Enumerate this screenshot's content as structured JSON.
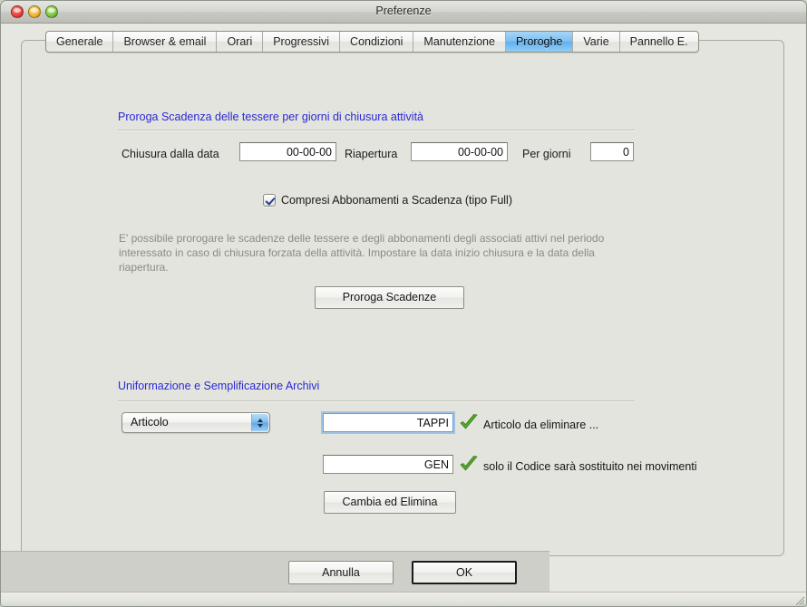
{
  "window": {
    "title": "Preferenze",
    "traffic_lights": [
      "close-button",
      "minimize-button",
      "zoom-button"
    ]
  },
  "tabs": [
    {
      "label": "Generale",
      "active": false
    },
    {
      "label": "Browser & email",
      "active": false
    },
    {
      "label": "Orari",
      "active": false
    },
    {
      "label": "Progressivi",
      "active": false
    },
    {
      "label": "Condizioni",
      "active": false
    },
    {
      "label": "Manutenzione",
      "active": false
    },
    {
      "label": "Proroghe",
      "active": true
    },
    {
      "label": "Varie",
      "active": false
    },
    {
      "label": "Pannello E.",
      "active": false
    }
  ],
  "section1": {
    "title": "Proroga Scadenza delle tessere per giorni di chiusura attività",
    "fields": {
      "closure_label": "Chiusura dalla data",
      "closure_value": "00-00-00",
      "reopen_label": "Riapertura",
      "reopen_value": "00-00-00",
      "days_label": "Per giorni",
      "days_value": "0"
    },
    "checkbox": {
      "label": "Compresi Abbonamenti a Scadenza (tipo Full)",
      "checked": true
    },
    "help_text": "E' possibile prorogare le scadenze delle tessere e degli abbonamenti degli associati attivi nel periodo interessato in caso di chiusura forzata della attività. Impostare la data inizio chiusura e la data della riapertura.",
    "action_button": "Proroga Scadenze"
  },
  "section2": {
    "title": "Uniformazione e Semplificazione Archivi",
    "popup": {
      "selected": "Articolo",
      "options": [
        "Articolo"
      ]
    },
    "row1": {
      "value": "TAPPI",
      "status_icon": "green-check-icon",
      "note": "Articolo da eliminare ..."
    },
    "row2": {
      "value": "GEN",
      "status_icon": "green-check-icon",
      "note": "solo il Codice sarà sostituito nei movimenti"
    },
    "action_button": "Cambia ed Elimina"
  },
  "footer": {
    "cancel_label": "Annulla",
    "ok_label": "OK"
  },
  "colors": {
    "accent_blue": "#2b28d8",
    "tab_active": "#5cb0ef",
    "check_green": "#4fa62c",
    "help_gray": "#8b8b85"
  }
}
